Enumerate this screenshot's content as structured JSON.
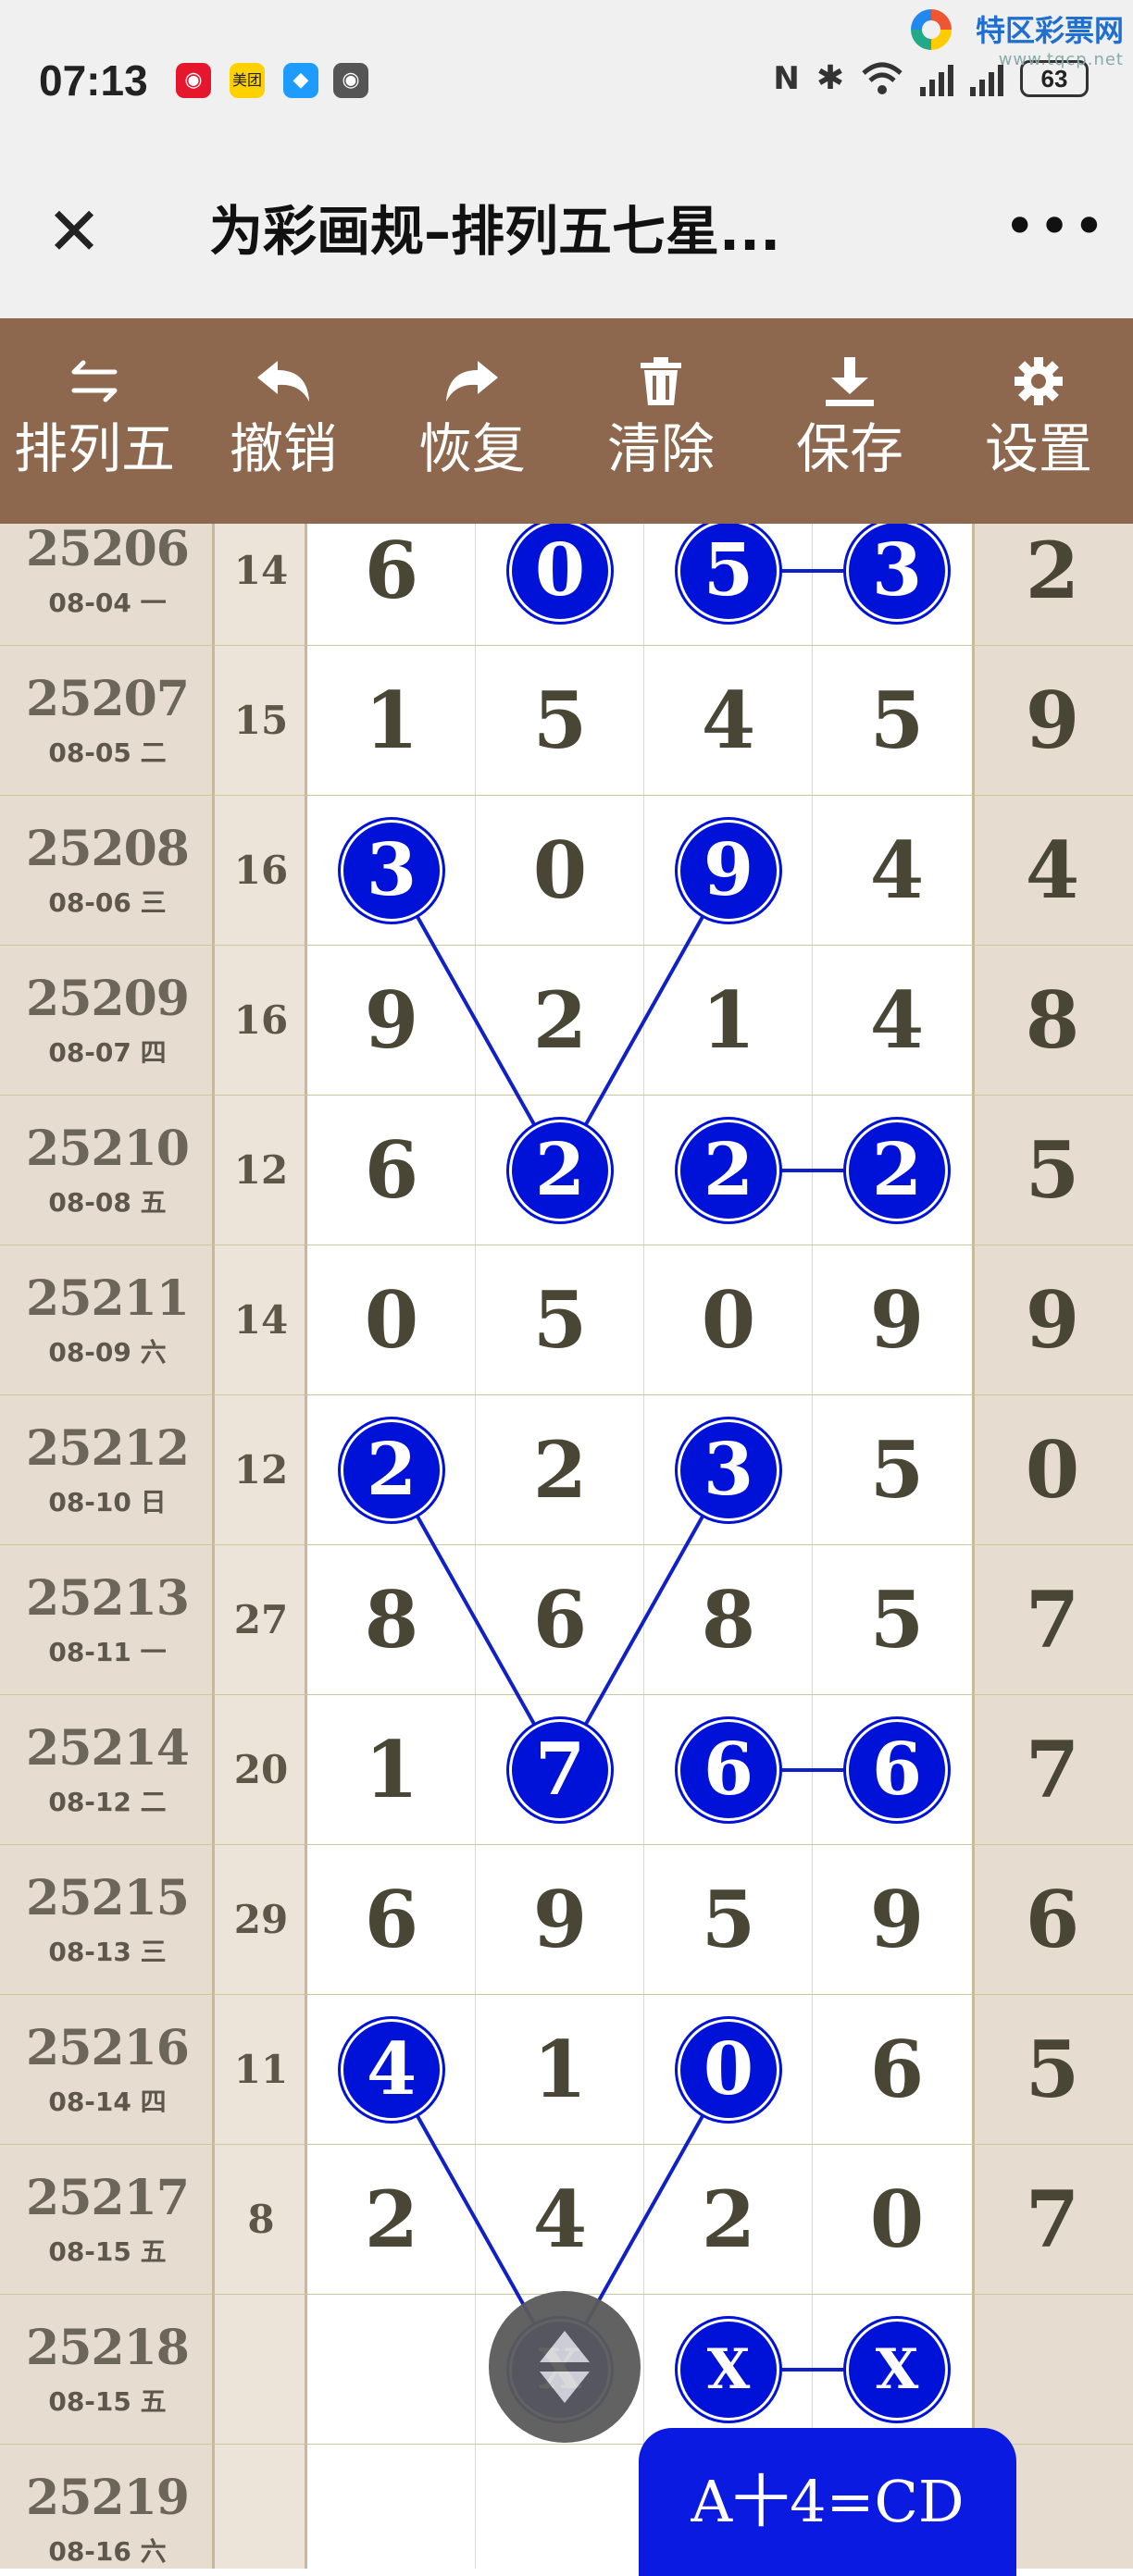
{
  "status_bar": {
    "time": "07:13",
    "apps": [
      {
        "icon": "weibo-icon",
        "text": "◉",
        "color": "#e6162d"
      },
      {
        "icon": "meituan-icon",
        "text": "美团",
        "color": "#ffd100"
      },
      {
        "icon": "chat-bubble-icon",
        "text": "◆",
        "color": "#1e9bff"
      },
      {
        "icon": "eye-icon",
        "text": "◉",
        "color": "#555555"
      }
    ],
    "battery": "63",
    "watermark_title": "特区彩票网",
    "watermark_url": "www.tqcp.net"
  },
  "title_bar": {
    "close_glyph": "✕",
    "title": "为彩画规–排列五七星...",
    "more_glyph": "•••"
  },
  "toolbar": {
    "items": [
      {
        "label": "排列五",
        "icon": "swap-arrows-icon"
      },
      {
        "label": "撤销",
        "icon": "undo-icon"
      },
      {
        "label": "恢复",
        "icon": "redo-icon"
      },
      {
        "label": "清除",
        "icon": "trash-icon"
      },
      {
        "label": "保存",
        "icon": "download-icon"
      },
      {
        "label": "设置",
        "icon": "gear-icon"
      }
    ]
  },
  "grid": {
    "rows": [
      {
        "period": "25206",
        "date": "08-04 一",
        "sum": "14",
        "digits": [
          "6",
          "0",
          "5",
          "3"
        ],
        "last": "2",
        "marked": [
          1,
          2,
          3
        ]
      },
      {
        "period": "25207",
        "date": "08-05 二",
        "sum": "15",
        "digits": [
          "1",
          "5",
          "4",
          "5"
        ],
        "last": "9",
        "marked": []
      },
      {
        "period": "25208",
        "date": "08-06 三",
        "sum": "16",
        "digits": [
          "3",
          "0",
          "9",
          "4"
        ],
        "last": "4",
        "marked": [
          0,
          2
        ]
      },
      {
        "period": "25209",
        "date": "08-07 四",
        "sum": "16",
        "digits": [
          "9",
          "2",
          "1",
          "4"
        ],
        "last": "8",
        "marked": []
      },
      {
        "period": "25210",
        "date": "08-08 五",
        "sum": "12",
        "digits": [
          "6",
          "2",
          "2",
          "2"
        ],
        "last": "5",
        "marked": [
          1,
          2,
          3
        ]
      },
      {
        "period": "25211",
        "date": "08-09 六",
        "sum": "14",
        "digits": [
          "0",
          "5",
          "0",
          "9"
        ],
        "last": "9",
        "marked": []
      },
      {
        "period": "25212",
        "date": "08-10 日",
        "sum": "12",
        "digits": [
          "2",
          "2",
          "3",
          "5"
        ],
        "last": "0",
        "marked": [
          0,
          2
        ]
      },
      {
        "period": "25213",
        "date": "08-11 一",
        "sum": "27",
        "digits": [
          "8",
          "6",
          "8",
          "5"
        ],
        "last": "7",
        "marked": []
      },
      {
        "period": "25214",
        "date": "08-12 二",
        "sum": "20",
        "digits": [
          "1",
          "7",
          "6",
          "6"
        ],
        "last": "7",
        "marked": [
          1,
          2,
          3
        ]
      },
      {
        "period": "25215",
        "date": "08-13 三",
        "sum": "29",
        "digits": [
          "6",
          "9",
          "5",
          "9"
        ],
        "last": "6",
        "marked": []
      },
      {
        "period": "25216",
        "date": "08-14 四",
        "sum": "11",
        "digits": [
          "4",
          "1",
          "0",
          "6"
        ],
        "last": "5",
        "marked": [
          0,
          2
        ]
      },
      {
        "period": "25217",
        "date": "08-15 五",
        "sum": "8",
        "digits": [
          "2",
          "4",
          "2",
          "0"
        ],
        "last": "7",
        "marked": []
      },
      {
        "period": "25218",
        "date": "08-15 五",
        "sum": "",
        "digits": [
          "",
          "X",
          "X",
          "X"
        ],
        "last": "",
        "marked": [
          1,
          2,
          3
        ]
      },
      {
        "period": "25219",
        "date": "08-16 六",
        "sum": "",
        "digits": [
          "",
          "",
          "",
          ""
        ],
        "last": "",
        "marked": []
      }
    ],
    "links": [
      {
        "from": [
          0,
          2
        ],
        "to": [
          0,
          3
        ]
      },
      {
        "from": [
          2,
          0
        ],
        "to": [
          4,
          1
        ]
      },
      {
        "from": [
          2,
          2
        ],
        "to": [
          4,
          1
        ]
      },
      {
        "from": [
          4,
          2
        ],
        "to": [
          4,
          3
        ]
      },
      {
        "from": [
          6,
          0
        ],
        "to": [
          8,
          1
        ]
      },
      {
        "from": [
          6,
          2
        ],
        "to": [
          8,
          1
        ]
      },
      {
        "from": [
          8,
          2
        ],
        "to": [
          8,
          3
        ]
      },
      {
        "from": [
          10,
          0
        ],
        "to": [
          12,
          1
        ]
      },
      {
        "from": [
          10,
          2
        ],
        "to": [
          12,
          1
        ]
      },
      {
        "from": [
          12,
          2
        ],
        "to": [
          12,
          3
        ]
      }
    ],
    "ball_color": "#0012d8",
    "line_color": "#1020c8"
  },
  "fab": {
    "icon": "scroll-up-down-icon"
  },
  "formula": {
    "text": "A十4=CD"
  }
}
